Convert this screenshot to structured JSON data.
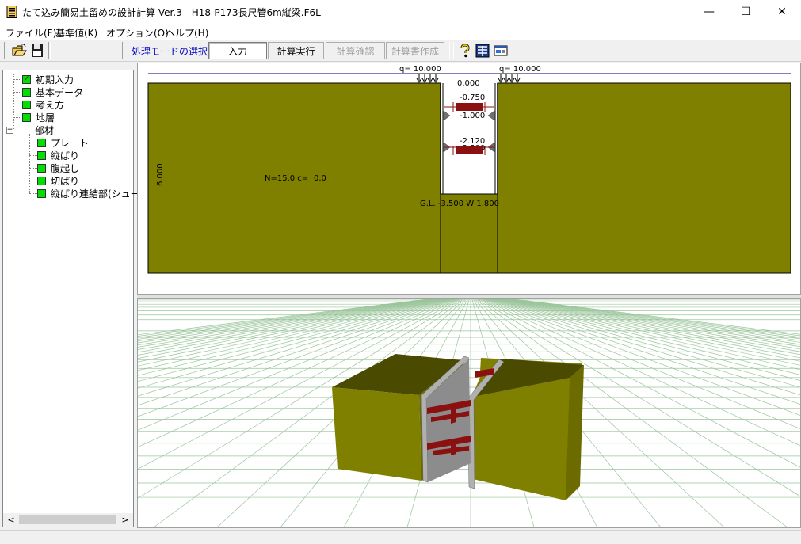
{
  "window": {
    "title": "たて込み簡易土留めの設計計算 Ver.3 - H18-P173長尺管6m縦梁.F6L",
    "min_glyph": "—",
    "max_glyph": "☐",
    "close_glyph": "✕"
  },
  "menu": {
    "items": [
      "ファイル(F)",
      "基準値(K)",
      "オプション(O)",
      "ヘルプ(H)"
    ]
  },
  "toolbar": {
    "mode_label": "処理モードの選択",
    "buttons": [
      {
        "label": "入力",
        "state": "active"
      },
      {
        "label": "計算実行",
        "state": "enabled"
      },
      {
        "label": "計算確認",
        "state": "disabled"
      },
      {
        "label": "計算書作成",
        "state": "disabled"
      }
    ],
    "icons": [
      "open-folder-icon",
      "save-disk-icon",
      "help-question-icon",
      "grid-view-icon",
      "card-icon"
    ]
  },
  "tree": {
    "items": [
      {
        "label": "初期入力",
        "checked": true
      },
      {
        "label": "基本データ"
      },
      {
        "label": "考え方"
      },
      {
        "label": "地層"
      },
      {
        "label": "部材",
        "expander": "−"
      },
      {
        "label": "プレート"
      },
      {
        "label": "縦ばり"
      },
      {
        "label": "腹起し"
      },
      {
        "label": "切ばり"
      },
      {
        "label": "縦ばり連結部(シュー"
      }
    ],
    "scroll_left": "<",
    "scroll_right": ">"
  },
  "section": {
    "load_left": "q= 10.000",
    "load_right": "q= 10.000",
    "top_level": "0.000",
    "strut1_level": "-0.750",
    "wale1_level": "-1.000",
    "strut2_level": "-2.120",
    "wale2_level": "-2.500",
    "depth_label": "6.000",
    "soil_label": "N=15.0 c=",
    "soil_c": "0.0",
    "bottom_label": "G.L. -3.500 W 1.800"
  },
  "colors": {
    "soil": "#7f7f00",
    "soil_top": "#4a4a00",
    "strut": "#8b1010",
    "grid": "#9ac49a",
    "check": "#00e000"
  }
}
